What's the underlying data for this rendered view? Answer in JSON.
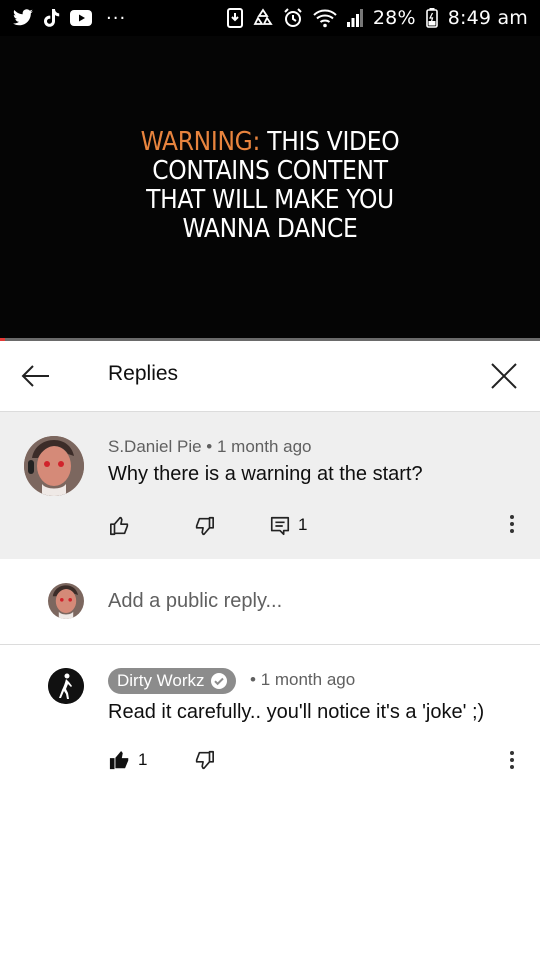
{
  "status_bar": {
    "left_icons": [
      "twitter-icon",
      "tiktok-icon",
      "youtube-icon"
    ],
    "more_dots": "···",
    "right_icons": [
      "download-icon",
      "recycle-icon",
      "alarm-icon",
      "wifi-icon",
      "signal-icon"
    ],
    "battery_text": "28%",
    "time": "8:49 am"
  },
  "video": {
    "warning_accent": "WARNING:",
    "warning_line1_rest": "THIS VIDEO",
    "warning_line2": "CONTAINS CONTENT",
    "warning_line3": "THAT WILL MAKE YOU",
    "warning_line4": "WANNA DANCE",
    "accent_color": "#e8843e",
    "progress_fraction": 0.01
  },
  "header": {
    "title": "Replies"
  },
  "parent_comment": {
    "author": "S.Daniel Pie",
    "separator": "•",
    "time": "1 month ago",
    "text": "Why there is a warning at the start?",
    "reply_count": "1"
  },
  "add_reply": {
    "placeholder": "Add a public reply..."
  },
  "reply": {
    "author": "Dirty Workz",
    "verified": true,
    "separator": "•",
    "time": "1 month ago",
    "text": "Read it carefully.. you'll notice it's a 'joke' ;)",
    "like_count": "1"
  }
}
